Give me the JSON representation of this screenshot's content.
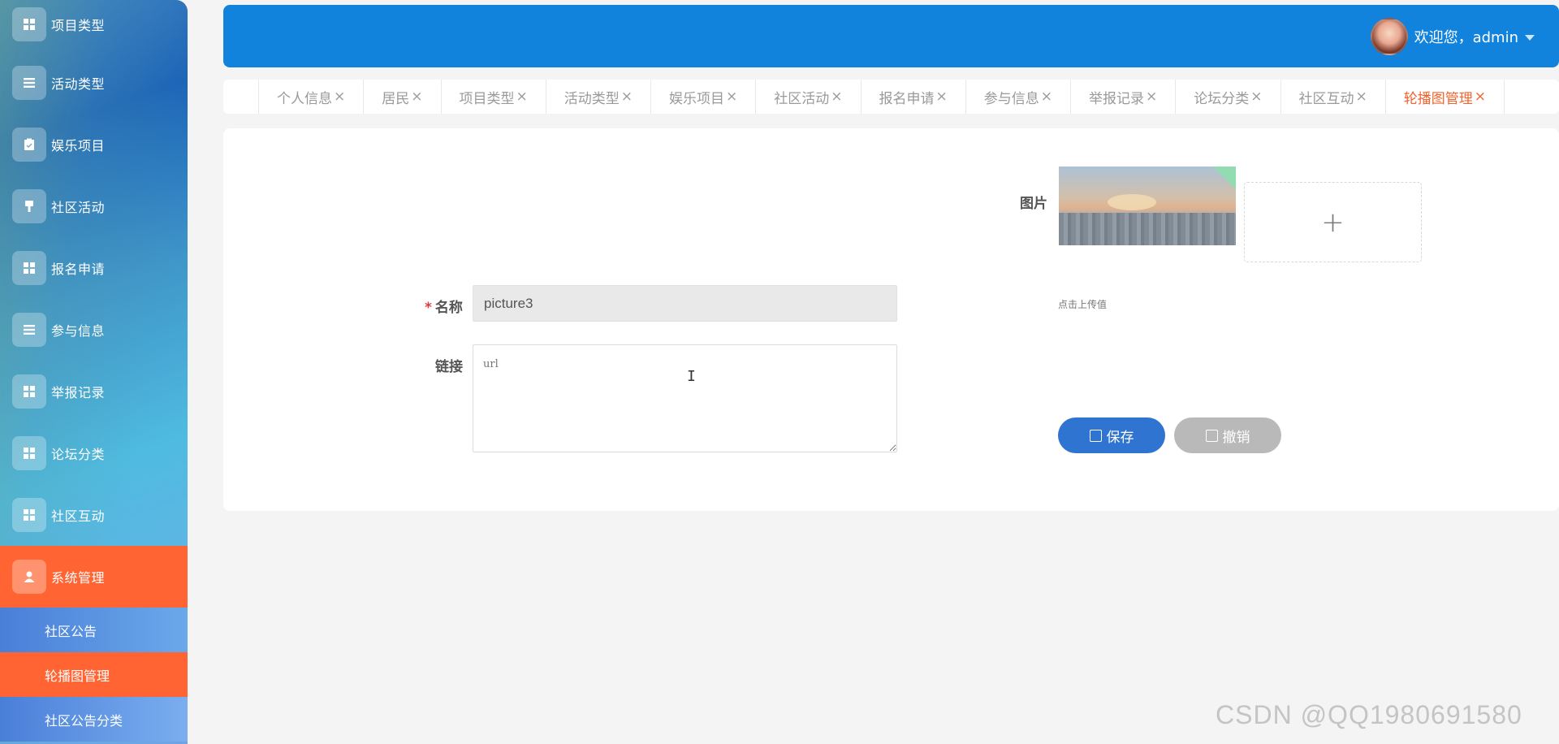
{
  "sidebar": {
    "items": [
      {
        "label": "项目类型",
        "icon": "grid-icon"
      },
      {
        "label": "活动类型",
        "icon": "list-icon"
      },
      {
        "label": "娱乐项目",
        "icon": "clipboard-icon"
      },
      {
        "label": "社区活动",
        "icon": "brush-icon"
      },
      {
        "label": "报名申请",
        "icon": "grid-icon"
      },
      {
        "label": "参与信息",
        "icon": "list-icon"
      },
      {
        "label": "举报记录",
        "icon": "grid-icon"
      },
      {
        "label": "论坛分类",
        "icon": "grid-icon"
      },
      {
        "label": "社区互动",
        "icon": "grid-icon"
      },
      {
        "label": "系统管理",
        "icon": "user-icon"
      }
    ],
    "sub_items": [
      {
        "label": "社区公告"
      },
      {
        "label": "轮播图管理"
      },
      {
        "label": "社区公告分类"
      }
    ]
  },
  "header": {
    "welcome": "欢迎您，admin"
  },
  "tabs": [
    {
      "label": "个人信息",
      "close": "×"
    },
    {
      "label": "居民",
      "close": "×"
    },
    {
      "label": "项目类型",
      "close": "×"
    },
    {
      "label": "活动类型",
      "close": "×"
    },
    {
      "label": "娱乐项目",
      "close": "×"
    },
    {
      "label": "社区活动",
      "close": "×"
    },
    {
      "label": "报名申请",
      "close": "×"
    },
    {
      "label": "参与信息",
      "close": "×"
    },
    {
      "label": "举报记录",
      "close": "×"
    },
    {
      "label": "论坛分类",
      "close": "×"
    },
    {
      "label": "社区互动",
      "close": "×"
    },
    {
      "label": "轮播图管理",
      "close": "×"
    }
  ],
  "form": {
    "image_label": "图片",
    "required_mark": "*",
    "name_label": "名称",
    "name_value": "picture3",
    "link_label": "链接",
    "link_placeholder": "url",
    "upload_plus": "+",
    "upload_hint": "点击上传值",
    "save_label": "保存",
    "cancel_label": "撤销"
  },
  "watermark": "CSDN @QQ1980691580",
  "colors": {
    "accent_orange": "#ff6432",
    "header_blue": "#1283dc",
    "save_blue": "#2f74d0",
    "cancel_gray": "#b9b9b9"
  }
}
